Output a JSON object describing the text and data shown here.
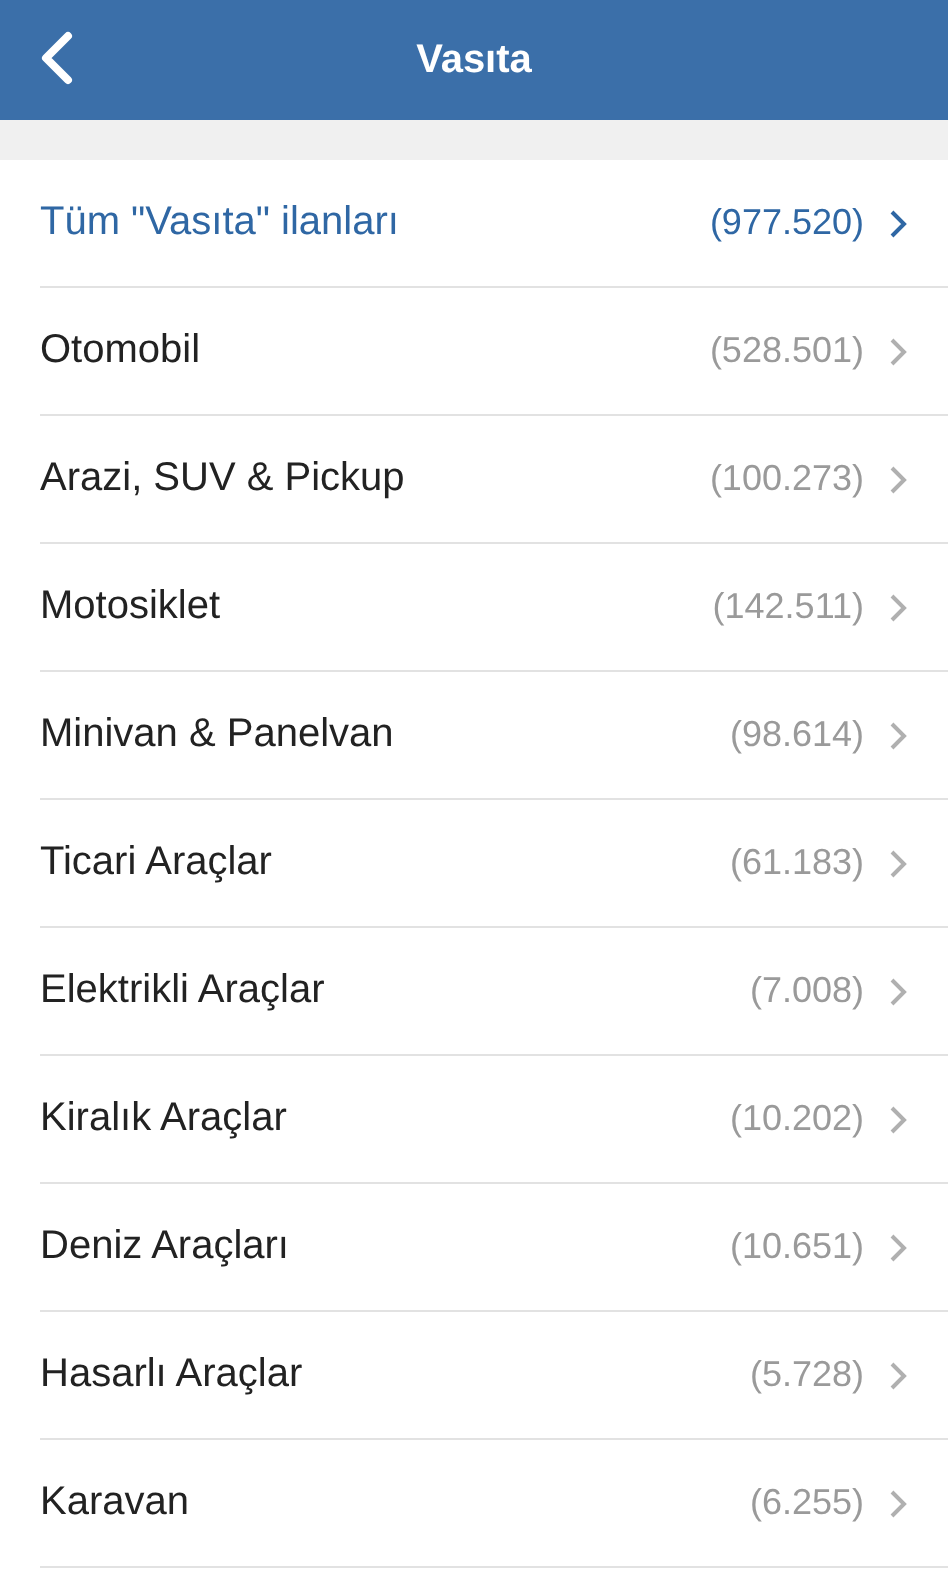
{
  "header": {
    "title": "Vasıta"
  },
  "items": [
    {
      "label": "Tüm \"Vasıta\" ilanları",
      "count": "(977.520)",
      "kind": "all"
    },
    {
      "label": "Otomobil",
      "count": "(528.501)",
      "kind": "category"
    },
    {
      "label": "Arazi, SUV & Pickup",
      "count": "(100.273)",
      "kind": "category"
    },
    {
      "label": "Motosiklet",
      "count": "(142.511)",
      "kind": "category"
    },
    {
      "label": "Minivan & Panelvan",
      "count": "(98.614)",
      "kind": "category"
    },
    {
      "label": "Ticari Araçlar",
      "count": "(61.183)",
      "kind": "category"
    },
    {
      "label": "Elektrikli Araçlar",
      "count": "(7.008)",
      "kind": "category"
    },
    {
      "label": "Kiralık Araçlar",
      "count": "(10.202)",
      "kind": "category"
    },
    {
      "label": "Deniz Araçları",
      "count": "(10.651)",
      "kind": "category"
    },
    {
      "label": "Hasarlı Araçlar",
      "count": "(5.728)",
      "kind": "category"
    },
    {
      "label": "Karavan",
      "count": "(6.255)",
      "kind": "category"
    }
  ]
}
